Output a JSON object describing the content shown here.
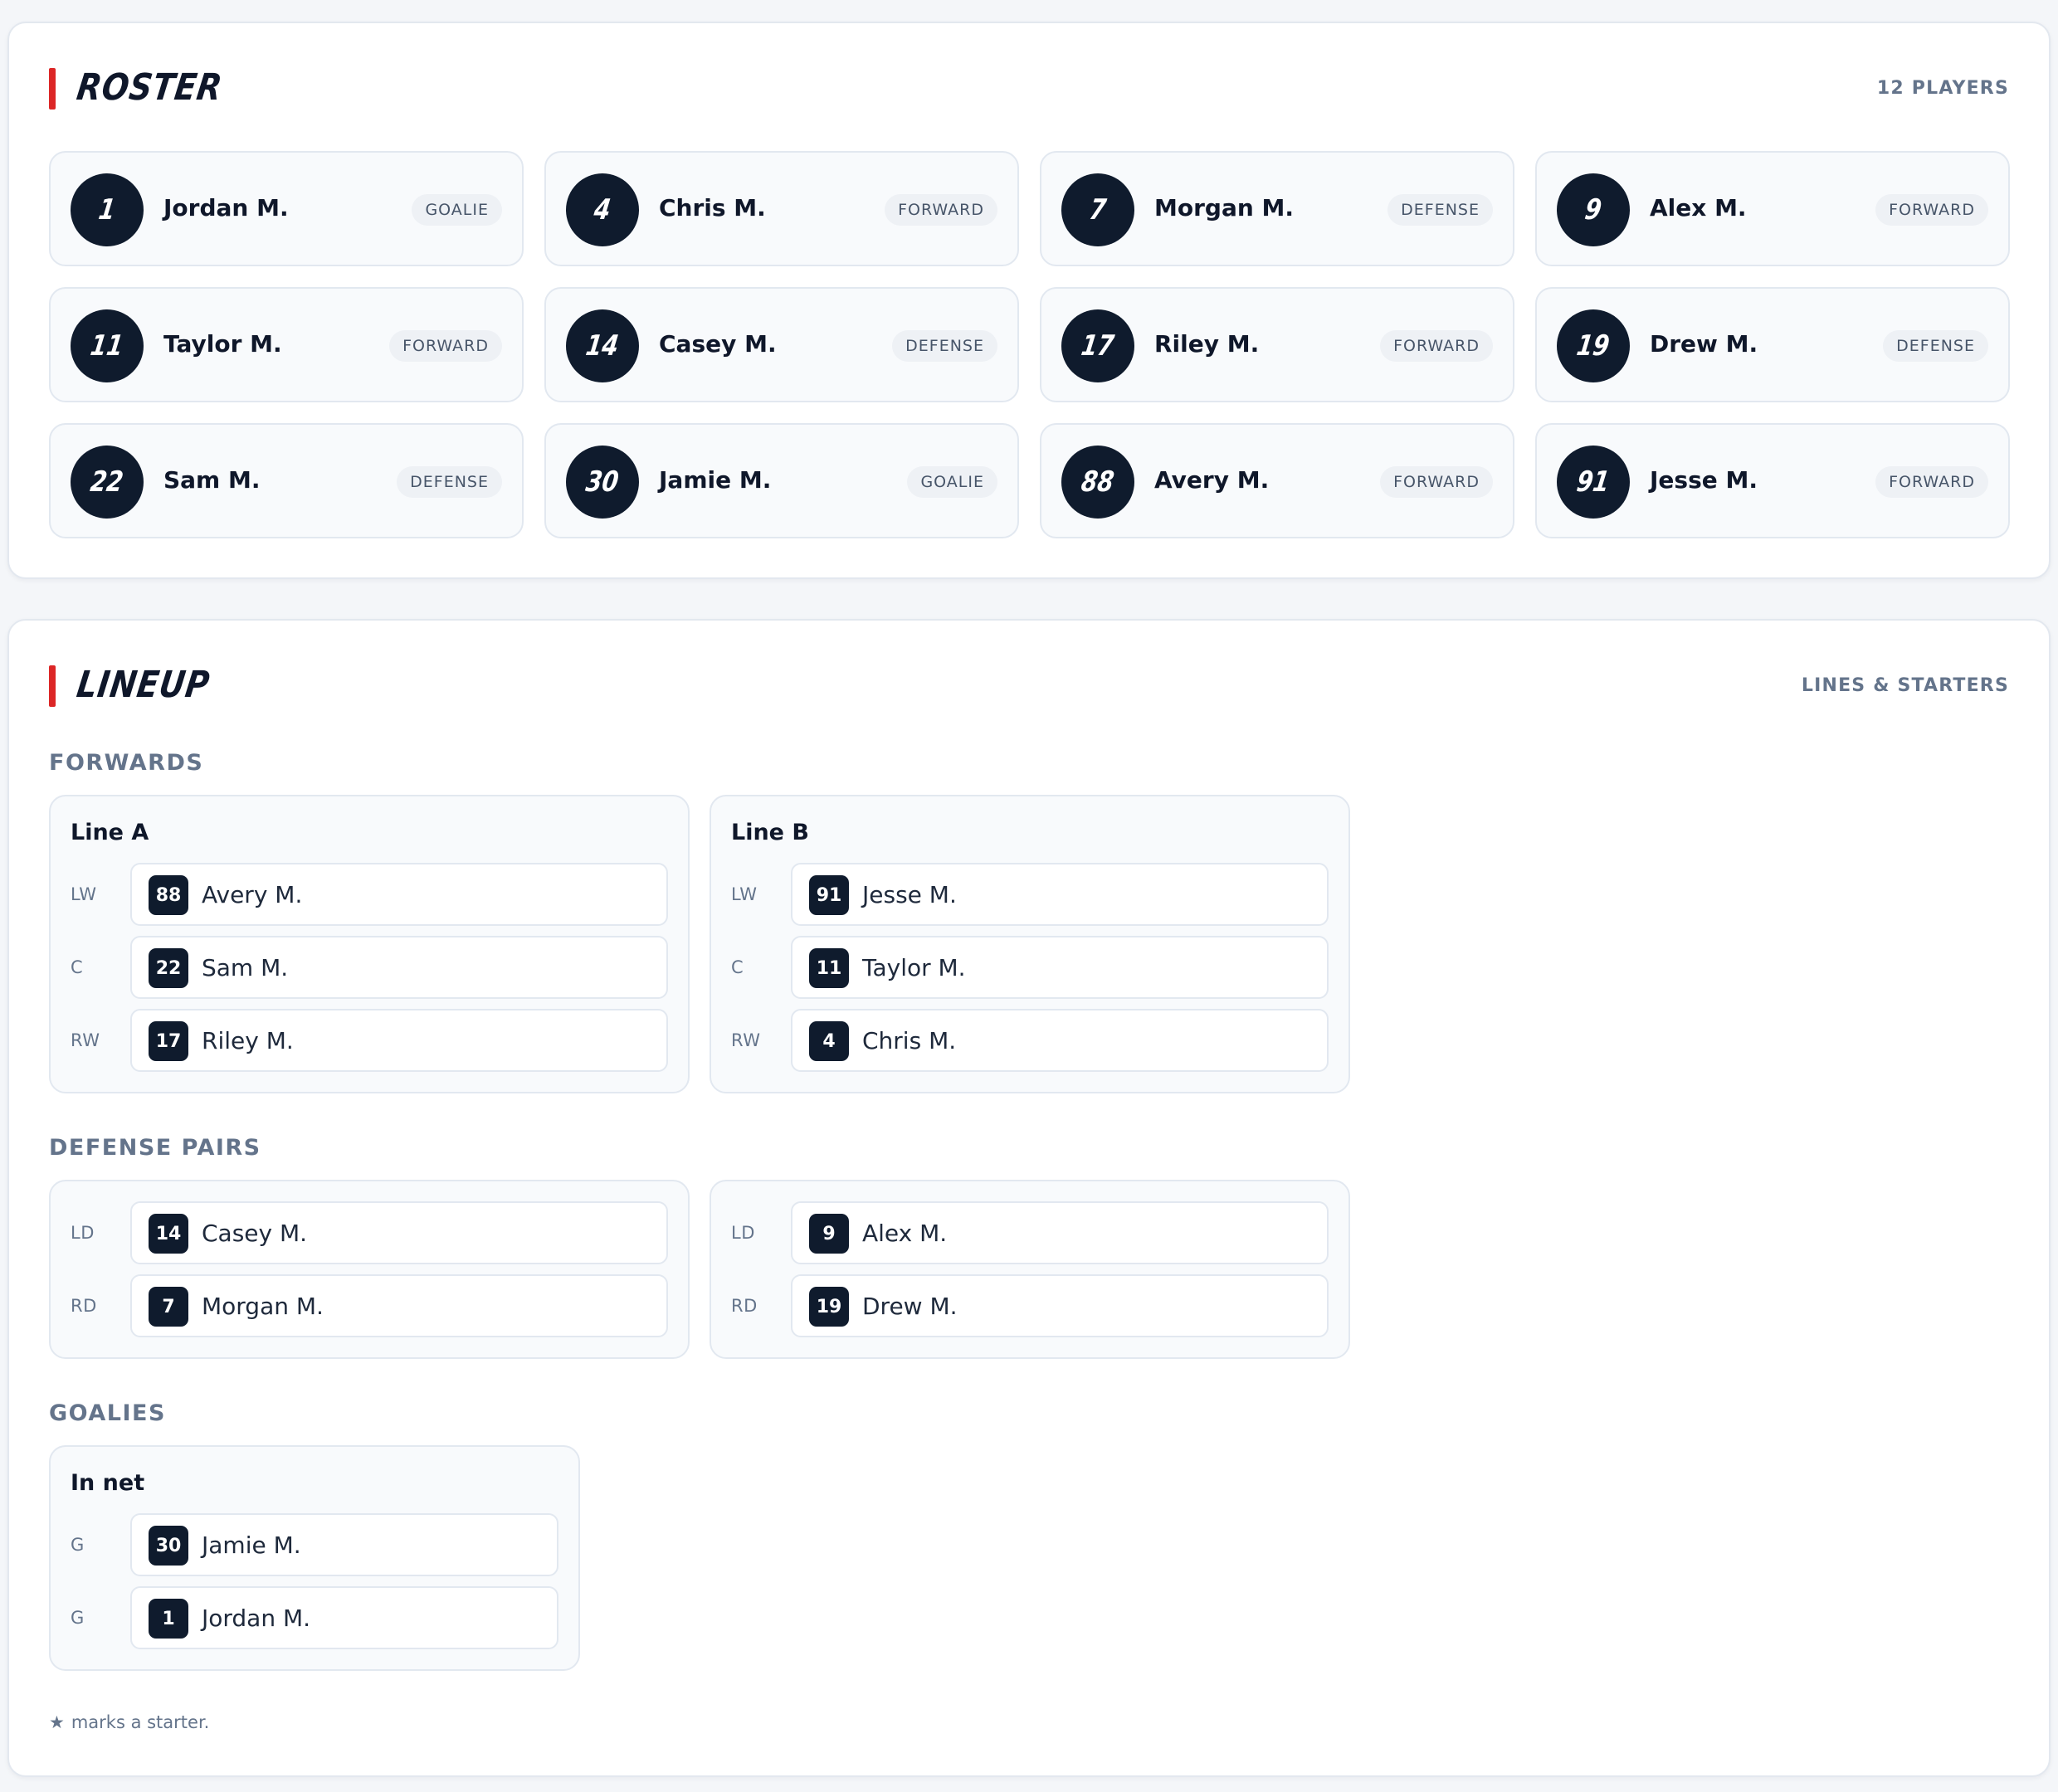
{
  "roster": {
    "title": "ROSTER",
    "meta": "12 PLAYERS",
    "players": [
      {
        "number": "1",
        "name": "Jordan M.",
        "position": "GOALIE"
      },
      {
        "number": "4",
        "name": "Chris M.",
        "position": "FORWARD"
      },
      {
        "number": "7",
        "name": "Morgan M.",
        "position": "DEFENSE"
      },
      {
        "number": "9",
        "name": "Alex M.",
        "position": "FORWARD"
      },
      {
        "number": "11",
        "name": "Taylor M.",
        "position": "FORWARD"
      },
      {
        "number": "14",
        "name": "Casey M.",
        "position": "DEFENSE"
      },
      {
        "number": "17",
        "name": "Riley M.",
        "position": "FORWARD"
      },
      {
        "number": "19",
        "name": "Drew M.",
        "position": "DEFENSE"
      },
      {
        "number": "22",
        "name": "Sam M.",
        "position": "DEFENSE"
      },
      {
        "number": "30",
        "name": "Jamie M.",
        "position": "GOALIE"
      },
      {
        "number": "88",
        "name": "Avery M.",
        "position": "FORWARD"
      },
      {
        "number": "91",
        "name": "Jesse M.",
        "position": "FORWARD"
      }
    ]
  },
  "lineup": {
    "title": "LINEUP",
    "meta": "LINES & STARTERS",
    "forwards_label": "FORWARDS",
    "forward_lines": [
      {
        "title": "Line A",
        "slots": [
          {
            "pos": "LW",
            "number": "88",
            "name": "Avery M."
          },
          {
            "pos": "C",
            "number": "22",
            "name": "Sam M."
          },
          {
            "pos": "RW",
            "number": "17",
            "name": "Riley M."
          }
        ]
      },
      {
        "title": "Line B",
        "slots": [
          {
            "pos": "LW",
            "number": "91",
            "name": "Jesse M."
          },
          {
            "pos": "C",
            "number": "11",
            "name": "Taylor M."
          },
          {
            "pos": "RW",
            "number": "4",
            "name": "Chris M."
          }
        ]
      }
    ],
    "defense_label": "DEFENSE PAIRS",
    "defense_pairs": [
      {
        "slots": [
          {
            "pos": "LD",
            "number": "14",
            "name": "Casey M."
          },
          {
            "pos": "RD",
            "number": "7",
            "name": "Morgan M."
          }
        ]
      },
      {
        "slots": [
          {
            "pos": "LD",
            "number": "9",
            "name": "Alex M."
          },
          {
            "pos": "RD",
            "number": "19",
            "name": "Drew M."
          }
        ]
      }
    ],
    "goalies_label": "GOALIES",
    "goalies": {
      "title": "In net",
      "slots": [
        {
          "pos": "G",
          "number": "30",
          "name": "Jamie M."
        },
        {
          "pos": "G",
          "number": "1",
          "name": "Jordan M."
        }
      ]
    },
    "footnote_star": "★",
    "footnote": "marks a starter."
  },
  "colors": {
    "accent": "#dc2626",
    "navy": "#0f1b2d",
    "muted": "#64748b"
  }
}
